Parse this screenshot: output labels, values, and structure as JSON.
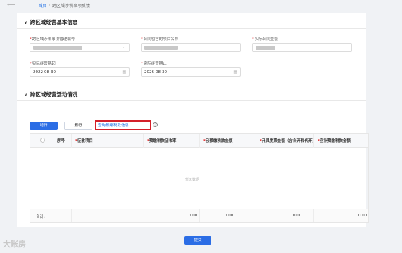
{
  "breadcrumb": {
    "home": "首页",
    "separator": "/",
    "current": "跨区域涉税事项反馈"
  },
  "section_basic": {
    "title": "跨区域经营基本信息",
    "fields": {
      "mgmt_no_label": "跨区域涉税事项管理编号",
      "project_name_label": "合同包含的项目名称",
      "contract_amount_label": "实际合同金额",
      "start_label": "实际经营期起",
      "start_value": "2022-08-30",
      "end_label": "实际经营期止",
      "end_value": "2026-08-30"
    }
  },
  "section_activity": {
    "title": "跨区域经营活动情况",
    "add_row": "增行",
    "delete_row": "删行",
    "query_link": "查询预缴税款信息",
    "info_icon": "ⓘ",
    "columns": {
      "index": "序号",
      "item": "征收项目",
      "rate": "预缴税款征收率",
      "prepaid": "已预缴税款金额",
      "invoice": "开具发票金额（含自开和代开）",
      "supplement": "应补预缴税款金额"
    },
    "empty_text": "暂无数据",
    "footer": {
      "total_label": "合计:",
      "v1": "0.00",
      "v2": "0.00",
      "v3": "0.00",
      "v4": "0.00"
    }
  },
  "submit": "提交",
  "watermark": "大账房"
}
